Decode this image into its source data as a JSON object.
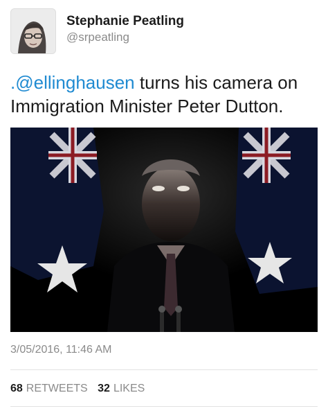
{
  "author": {
    "name": "Stephanie Peatling",
    "handle": "@srpeatling"
  },
  "tweet": {
    "mention": ".@ellinghausen",
    "text_line1_rest": " turns his camera on",
    "text_line2": "Immigration Minister Peter Dutton."
  },
  "media": {
    "icon": "photo"
  },
  "timestamp": "3/05/2016, 11:46 AM",
  "stats": {
    "retweets_count": "68",
    "retweets_label": "RETWEETS",
    "likes_count": "32",
    "likes_label": "LIKES"
  },
  "colors": {
    "link": "#1f8ad1",
    "muted": "#8a8a8a",
    "text": "#1b1b1b"
  }
}
